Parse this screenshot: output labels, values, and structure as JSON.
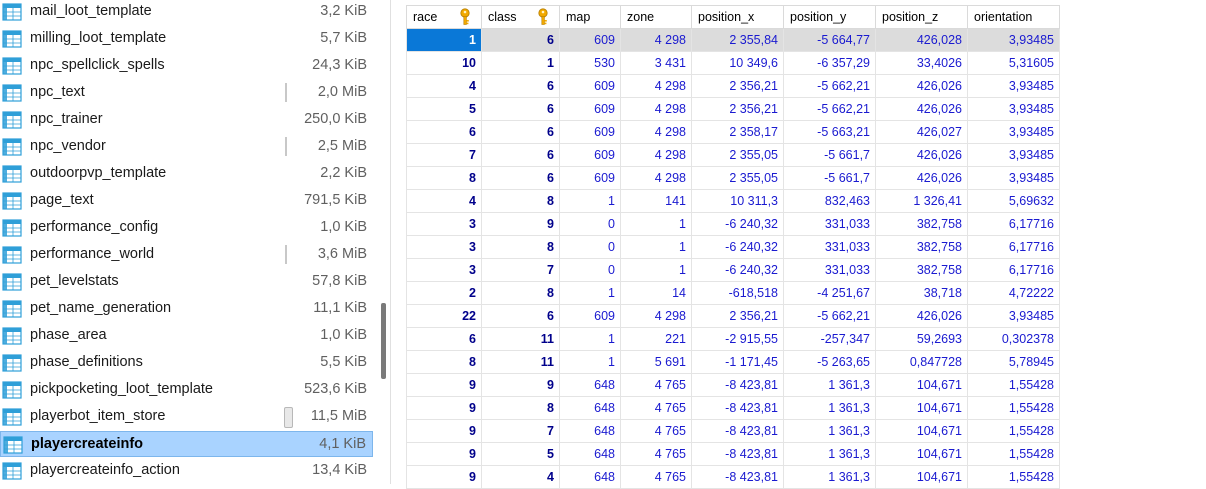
{
  "tables": [
    {
      "name": "mail_loot_template",
      "size": "3,2 KiB",
      "bar": "none"
    },
    {
      "name": "milling_loot_template",
      "size": "5,7 KiB",
      "bar": "none"
    },
    {
      "name": "npc_spellclick_spells",
      "size": "24,3 KiB",
      "bar": "none"
    },
    {
      "name": "npc_text",
      "size": "2,0 MiB",
      "bar": "thin"
    },
    {
      "name": "npc_trainer",
      "size": "250,0 KiB",
      "bar": "none"
    },
    {
      "name": "npc_vendor",
      "size": "2,5 MiB",
      "bar": "thin"
    },
    {
      "name": "outdoorpvp_template",
      "size": "2,2 KiB",
      "bar": "none"
    },
    {
      "name": "page_text",
      "size": "791,5 KiB",
      "bar": "none"
    },
    {
      "name": "performance_config",
      "size": "1,0 KiB",
      "bar": "none"
    },
    {
      "name": "performance_world",
      "size": "3,6 MiB",
      "bar": "thin"
    },
    {
      "name": "pet_levelstats",
      "size": "57,8 KiB",
      "bar": "none"
    },
    {
      "name": "pet_name_generation",
      "size": "11,1 KiB",
      "bar": "none"
    },
    {
      "name": "phase_area",
      "size": "1,0 KiB",
      "bar": "none"
    },
    {
      "name": "phase_definitions",
      "size": "5,5 KiB",
      "bar": "none"
    },
    {
      "name": "pickpocketing_loot_template",
      "size": "523,6 KiB",
      "bar": "none"
    },
    {
      "name": "playerbot_item_store",
      "size": "11,5 MiB",
      "bar": "large"
    },
    {
      "name": "playercreateinfo",
      "size": "4,1 KiB",
      "bar": "none",
      "selected": true
    },
    {
      "name": "playercreateinfo_action",
      "size": "13,4 KiB",
      "bar": "none"
    }
  ],
  "grid": {
    "columns": [
      {
        "label": "race",
        "key": true
      },
      {
        "label": "class",
        "key": true
      },
      {
        "label": "map",
        "key": false
      },
      {
        "label": "zone",
        "key": false
      },
      {
        "label": "position_x",
        "key": false
      },
      {
        "label": "position_y",
        "key": false
      },
      {
        "label": "position_z",
        "key": false
      },
      {
        "label": "orientation",
        "key": false
      }
    ],
    "rows": [
      [
        "1",
        "6",
        "609",
        "4 298",
        "2 355,84",
        "-5 664,77",
        "426,028",
        "3,93485"
      ],
      [
        "10",
        "1",
        "530",
        "3 431",
        "10 349,6",
        "-6 357,29",
        "33,4026",
        "5,31605"
      ],
      [
        "4",
        "6",
        "609",
        "4 298",
        "2 356,21",
        "-5 662,21",
        "426,026",
        "3,93485"
      ],
      [
        "5",
        "6",
        "609",
        "4 298",
        "2 356,21",
        "-5 662,21",
        "426,026",
        "3,93485"
      ],
      [
        "6",
        "6",
        "609",
        "4 298",
        "2 358,17",
        "-5 663,21",
        "426,027",
        "3,93485"
      ],
      [
        "7",
        "6",
        "609",
        "4 298",
        "2 355,05",
        "-5 661,7",
        "426,026",
        "3,93485"
      ],
      [
        "8",
        "6",
        "609",
        "4 298",
        "2 355,05",
        "-5 661,7",
        "426,026",
        "3,93485"
      ],
      [
        "4",
        "8",
        "1",
        "141",
        "10 311,3",
        "832,463",
        "1 326,41",
        "5,69632"
      ],
      [
        "3",
        "9",
        "0",
        "1",
        "-6 240,32",
        "331,033",
        "382,758",
        "6,17716"
      ],
      [
        "3",
        "8",
        "0",
        "1",
        "-6 240,32",
        "331,033",
        "382,758",
        "6,17716"
      ],
      [
        "3",
        "7",
        "0",
        "1",
        "-6 240,32",
        "331,033",
        "382,758",
        "6,17716"
      ],
      [
        "2",
        "8",
        "1",
        "14",
        "-618,518",
        "-4 251,67",
        "38,718",
        "4,72222"
      ],
      [
        "22",
        "6",
        "609",
        "4 298",
        "2 356,21",
        "-5 662,21",
        "426,026",
        "3,93485"
      ],
      [
        "6",
        "11",
        "1",
        "221",
        "-2 915,55",
        "-257,347",
        "59,2693",
        "0,302378"
      ],
      [
        "8",
        "11",
        "1",
        "5 691",
        "-1 171,45",
        "-5 263,65",
        "0,847728",
        "5,78945"
      ],
      [
        "9",
        "9",
        "648",
        "4 765",
        "-8 423,81",
        "1 361,3",
        "104,671",
        "1,55428"
      ],
      [
        "9",
        "8",
        "648",
        "4 765",
        "-8 423,81",
        "1 361,3",
        "104,671",
        "1,55428"
      ],
      [
        "9",
        "7",
        "648",
        "4 765",
        "-8 423,81",
        "1 361,3",
        "104,671",
        "1,55428"
      ],
      [
        "9",
        "5",
        "648",
        "4 765",
        "-8 423,81",
        "1 361,3",
        "104,671",
        "1,55428"
      ],
      [
        "9",
        "4",
        "648",
        "4 765",
        "-8 423,81",
        "1 361,3",
        "104,671",
        "1,55428"
      ]
    ],
    "selected_row": 0
  },
  "icons": {
    "table": "table-icon",
    "key": "primary-key-icon"
  },
  "colors": {
    "selection_bg": "#a9d3ff",
    "cell_cursor": "#0a78d7",
    "cell_text": "#1a1ad0",
    "key_text": "#00008b",
    "table_icon": "#2f9fd8",
    "key_icon": "#f2a900"
  }
}
